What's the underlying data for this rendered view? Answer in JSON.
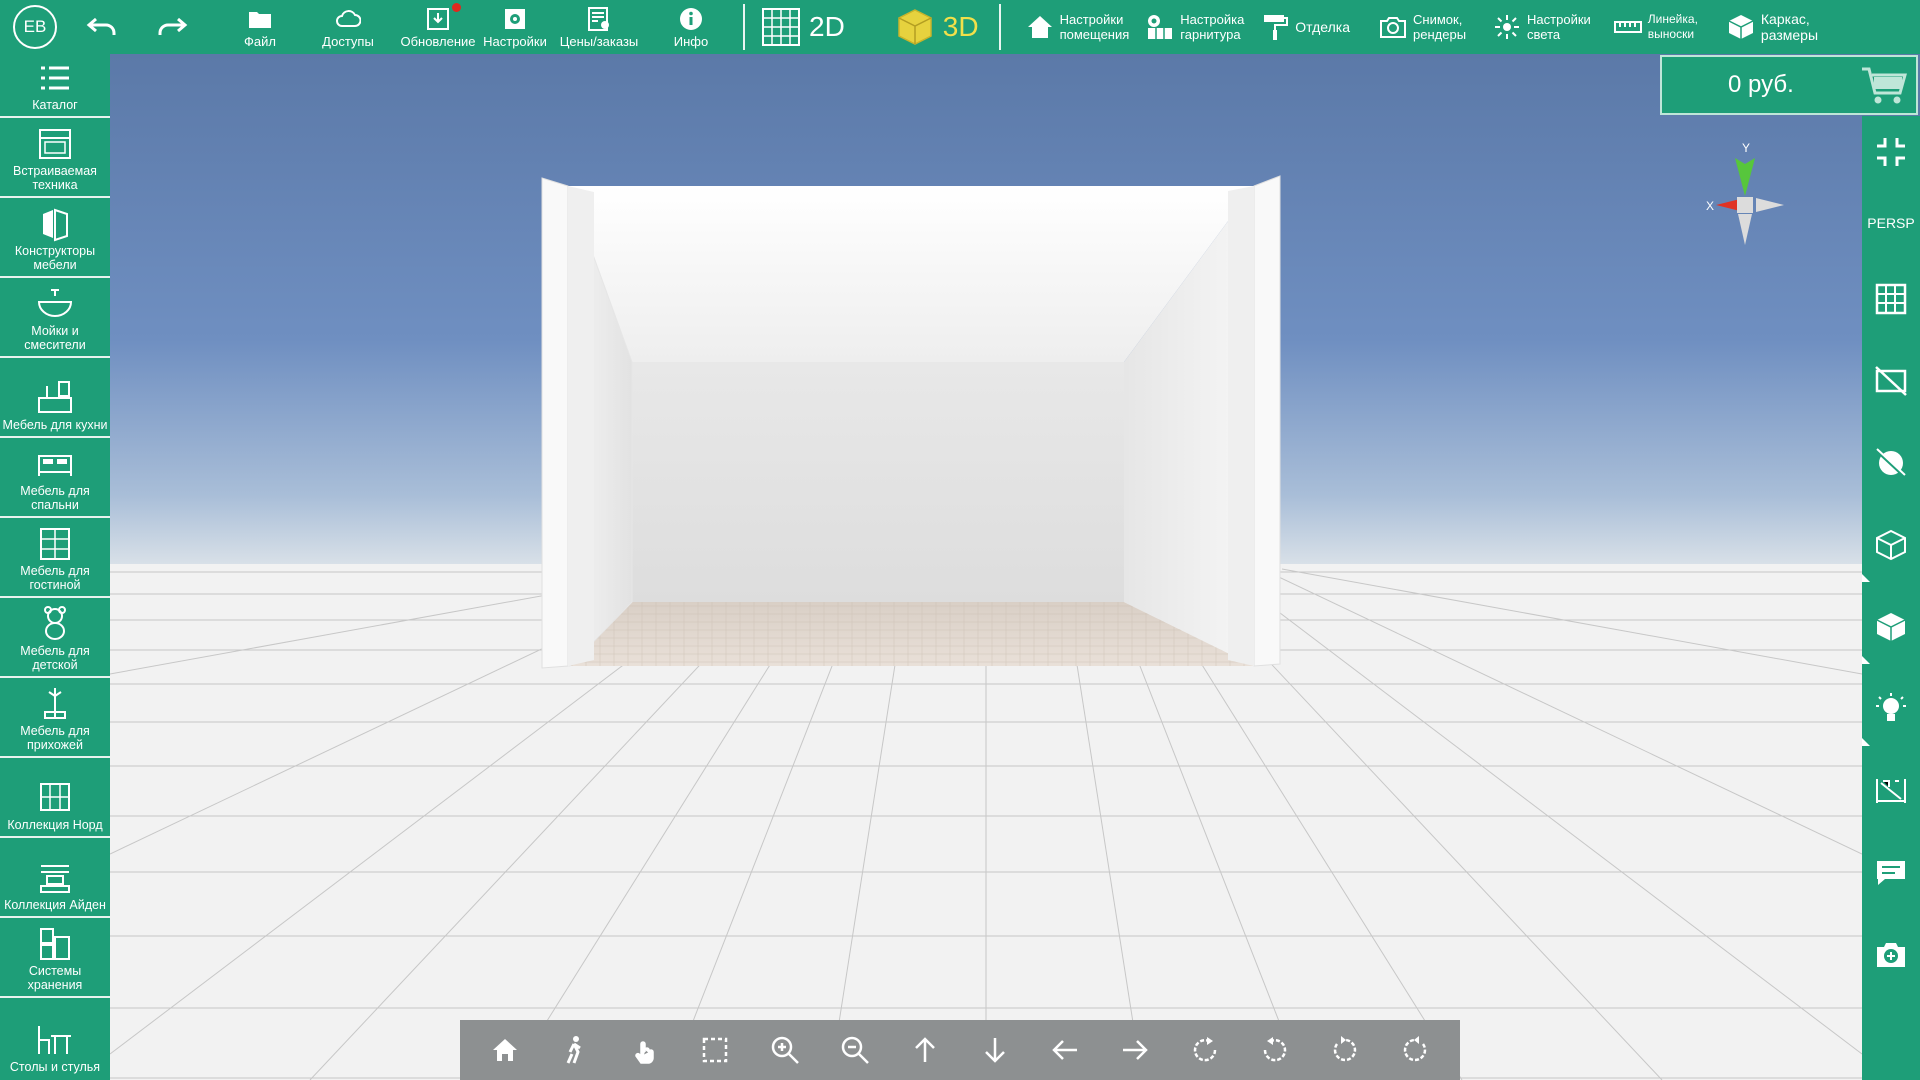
{
  "topbar": {
    "avatar": "EB",
    "undo_icon": "undo-icon",
    "redo_icon": "redo-icon",
    "buttons": [
      {
        "label": "Файл",
        "icon": "folder-icon"
      },
      {
        "label": "Доступы",
        "icon": "cloud-icon"
      },
      {
        "label": "Обновление",
        "icon": "download-icon",
        "badge": true
      },
      {
        "label": "Настройки",
        "icon": "settings-icon"
      },
      {
        "label": "Цены/заказы",
        "icon": "price-list-icon"
      },
      {
        "label": "Инфо",
        "icon": "info-icon"
      }
    ],
    "mode_2d": "2D",
    "mode_3d": "3D",
    "right_buttons": [
      {
        "line1": "Настройки",
        "line2": "помещения",
        "icon": "home-icon"
      },
      {
        "line1": "Настройка",
        "line2": "гарнитура",
        "icon": "furniture-settings-icon"
      },
      {
        "line1": "Отделка",
        "line2": "",
        "icon": "paint-roller-icon"
      },
      {
        "line1": "Снимок,",
        "line2": "рендеры",
        "icon": "camera-icon"
      },
      {
        "line1": "Настройки",
        "line2": "света",
        "icon": "light-icon"
      },
      {
        "line1": "Линейка,",
        "line2": "выноски",
        "icon": "ruler-icon"
      },
      {
        "line1": "Каркас,",
        "line2": "размеры",
        "icon": "box-frame-icon"
      }
    ],
    "accent": "#1e9e78",
    "active_mode_color": "#f2e04a"
  },
  "sidebar": {
    "items": [
      {
        "label": "Каталог",
        "icon": "list-icon"
      },
      {
        "label": "Встраиваемая техника",
        "icon": "oven-icon"
      },
      {
        "label": "Конструкторы мебели",
        "icon": "furniture-builder-icon"
      },
      {
        "label": "Мойки и смесители",
        "icon": "sink-icon"
      },
      {
        "label": "Мебель для кухни",
        "icon": "kitchen-icon"
      },
      {
        "label": "Мебель для спальни",
        "icon": "bed-icon"
      },
      {
        "label": "Мебель для гостиной",
        "icon": "living-room-icon"
      },
      {
        "label": "Мебель для детской",
        "icon": "teddy-bear-icon"
      },
      {
        "label": "Мебель для прихожей",
        "icon": "hallway-icon"
      },
      {
        "label": "Коллекция Норд",
        "icon": "nord-collection-icon"
      },
      {
        "label": "Коллекция Айден",
        "icon": "aiden-collection-icon"
      },
      {
        "label": "Системы хранения",
        "icon": "storage-icon"
      },
      {
        "label": "Столы и стулья",
        "icon": "table-chair-icon"
      }
    ]
  },
  "price": {
    "value": "0 руб.",
    "icon": "cart-icon"
  },
  "rightbar": {
    "persp_label": "PERSP",
    "buttons": [
      "collapse-icon",
      "persp-toggle",
      "grid-icon",
      "hide-walls-icon",
      "no-textures-icon",
      "wireframe-cube-icon",
      "solid-cube-icon",
      "light-bulb-icon",
      "dimensions-icon",
      "comment-icon",
      "add-camera-icon"
    ]
  },
  "compass": {
    "x_label": "X",
    "y_label": "Y"
  },
  "bottombar": {
    "buttons": [
      "home-view-icon",
      "walk-icon",
      "hand-pan-icon",
      "select-area-icon",
      "zoom-in-icon",
      "zoom-out-icon",
      "arrow-up-icon",
      "arrow-down-icon",
      "arrow-left-icon",
      "arrow-right-icon",
      "rotate-icon",
      "rotate-back-icon",
      "rotate-left-icon",
      "rotate-right-icon"
    ]
  }
}
